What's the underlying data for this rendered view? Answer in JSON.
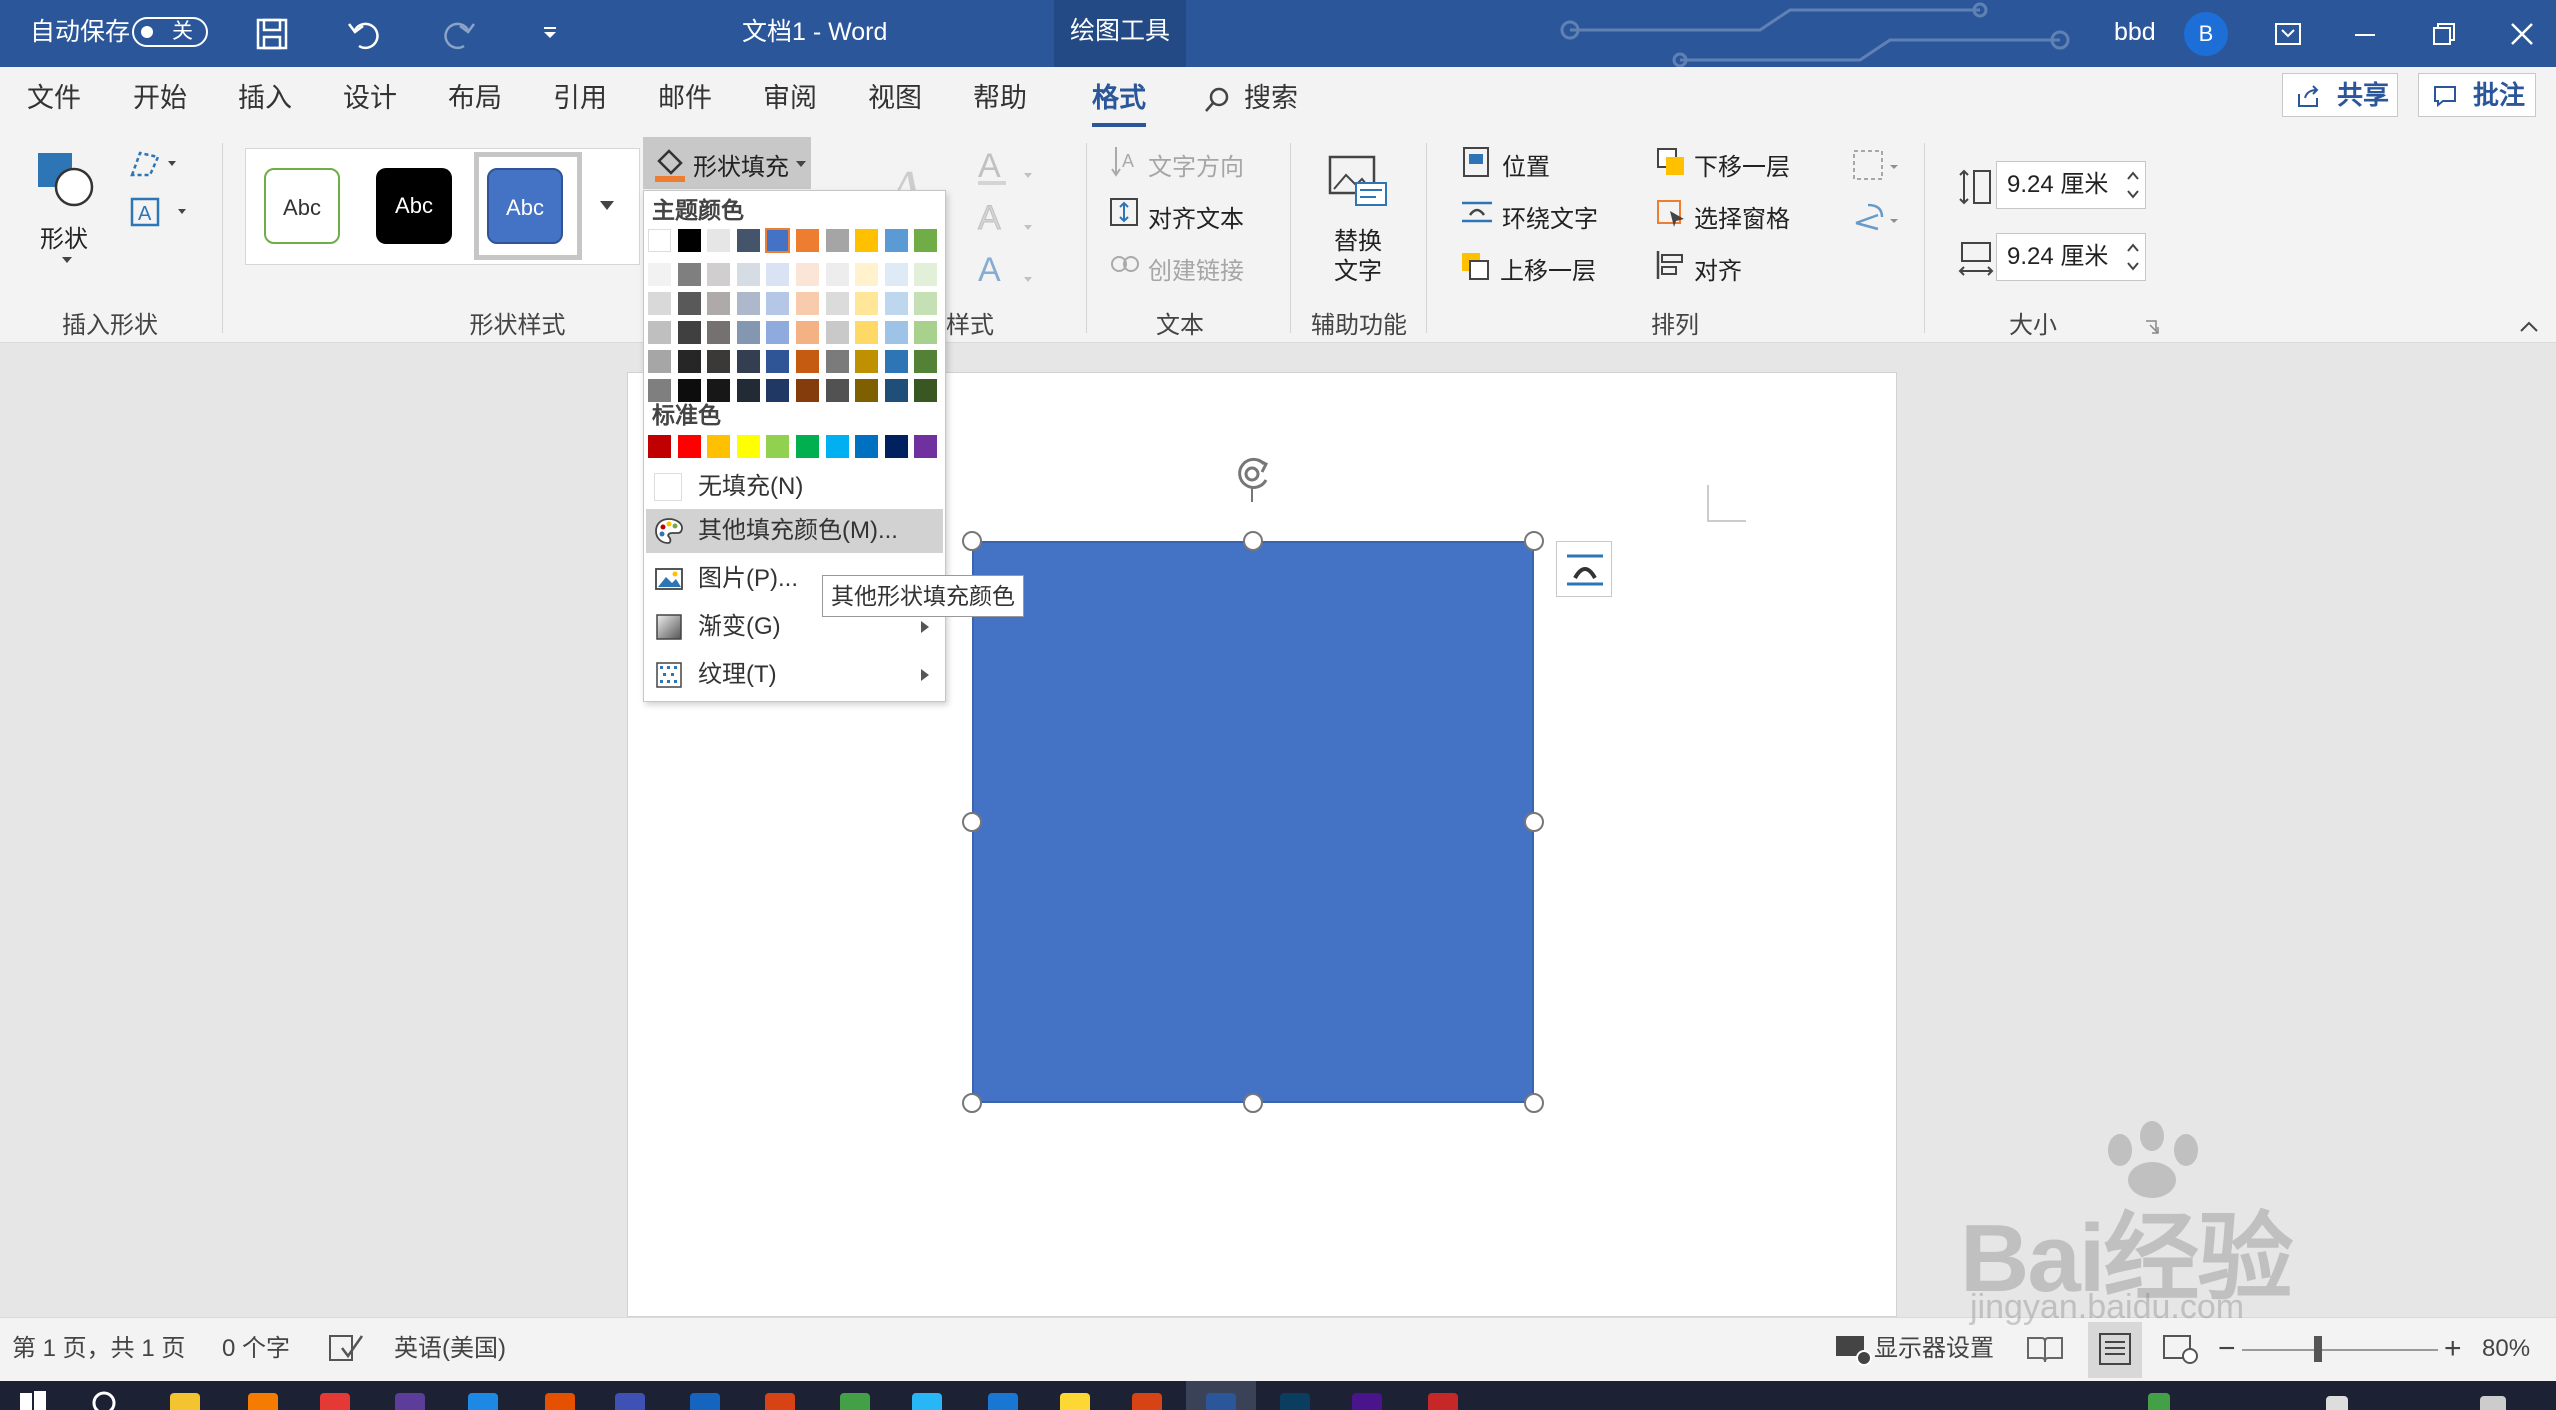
{
  "titlebar": {
    "autosave_label": "自动保存",
    "autosave_state": "关",
    "doc_title": "文档1  -  Word",
    "contextual_tab": "绘图工具",
    "user_name": "bbd",
    "user_initial": "B"
  },
  "tabs": [
    "文件",
    "开始",
    "插入",
    "设计",
    "布局",
    "引用",
    "邮件",
    "审阅",
    "视图",
    "帮助",
    "格式"
  ],
  "active_tab": "格式",
  "search_label": "搜索",
  "share_label": "共享",
  "comments_label": "批注",
  "ribbon": {
    "insert_shapes": {
      "shapes_label": "形状",
      "group_label": "插入形状"
    },
    "shape_styles": {
      "style_sample": "Abc",
      "shape_fill_label": "形状填充",
      "group_label": "形状样式"
    },
    "wordart_group_label_fragment": "样式",
    "text": {
      "text_direction": "文字方向",
      "align_text": "对齐文本",
      "create_link": "创建链接",
      "group_label": "文本"
    },
    "accessibility": {
      "alt_text_line1": "替换",
      "alt_text_line2": "文字",
      "group_label": "辅助功能"
    },
    "arrange": {
      "position": "位置",
      "wrap_text": "环绕文字",
      "bring_forward": "上移一层",
      "send_backward": "下移一层",
      "selection_pane": "选择窗格",
      "align": "对齐",
      "group_label": "排列"
    },
    "size": {
      "height": "9.24 厘米",
      "width": "9.24 厘米",
      "group_label": "大小"
    }
  },
  "fill_menu": {
    "theme_colors_label": "主题颜色",
    "standard_colors_label": "标准色",
    "theme_top_row": [
      "#ffffff",
      "#000000",
      "#e7e6e6",
      "#44546a",
      "#4472c4",
      "#ed7d31",
      "#a5a5a5",
      "#ffc000",
      "#5b9bd5",
      "#70ad47"
    ],
    "theme_shades": [
      [
        "#f2f2f2",
        "#7f7f7f",
        "#d0cece",
        "#d6dce4",
        "#dae3f3",
        "#fbe5d6",
        "#ededed",
        "#fff2cc",
        "#deebf7",
        "#e2f0d9"
      ],
      [
        "#d9d9d9",
        "#595959",
        "#aeaaaa",
        "#adb9ca",
        "#b4c7e7",
        "#f8cbad",
        "#dbdbdb",
        "#ffe699",
        "#bdd7ee",
        "#c5e0b4"
      ],
      [
        "#bfbfbf",
        "#404040",
        "#767171",
        "#8497b0",
        "#8faadc",
        "#f4b183",
        "#c9c9c9",
        "#ffd966",
        "#9dc3e6",
        "#a9d18e"
      ],
      [
        "#a6a6a6",
        "#262626",
        "#3b3838",
        "#333f50",
        "#2f5597",
        "#c55a11",
        "#7b7b7b",
        "#bf9000",
        "#2e75b6",
        "#538135"
      ],
      [
        "#7f7f7f",
        "#0d0d0d",
        "#171717",
        "#222a35",
        "#203864",
        "#843c0c",
        "#525252",
        "#7f6000",
        "#1f4e79",
        "#385723"
      ]
    ],
    "standard_colors": [
      "#c00000",
      "#ff0000",
      "#ffc000",
      "#ffff00",
      "#92d050",
      "#00b050",
      "#00b0f0",
      "#0070c0",
      "#002060",
      "#7030a0"
    ],
    "no_fill": "无填充(N)",
    "more_fill_colors": "其他填充颜色(M)...",
    "picture": "图片(P)...",
    "gradient": "渐变(G)",
    "texture": "纹理(T)",
    "tooltip": "其他形状填充颜色"
  },
  "shape_color": "#4472c4",
  "status": {
    "page_info": "第 1 页，共 1 页",
    "word_count": "0 个字",
    "language": "英语(美国)",
    "display_settings": "显示器设置",
    "zoom_level": "80%"
  },
  "watermark": {
    "brand": "Bai经验",
    "url": "jingyan.baidu.com"
  }
}
